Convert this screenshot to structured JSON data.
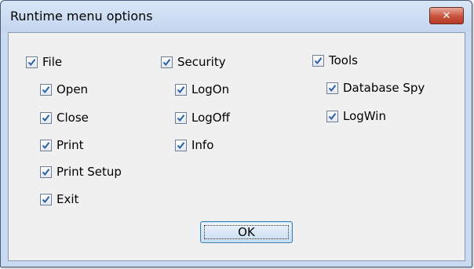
{
  "window": {
    "title": "Runtime menu options",
    "close_icon": "close-icon",
    "close_glyph": "✕"
  },
  "colors": {
    "check": "#2a5fa8",
    "close_button": "#c8533d",
    "title_bar": "#c9daf0",
    "ok_border": "#3c7fb1"
  },
  "groups": {
    "file": {
      "label": "File",
      "checked": true,
      "items": [
        {
          "label": "Open",
          "checked": true
        },
        {
          "label": "Close",
          "checked": true
        },
        {
          "label": "Print",
          "checked": true
        },
        {
          "label": "Print Setup",
          "checked": true
        },
        {
          "label": "Exit",
          "checked": true
        }
      ]
    },
    "security": {
      "label": "Security",
      "checked": true,
      "items": [
        {
          "label": "LogOn",
          "checked": true
        },
        {
          "label": "LogOff",
          "checked": true
        },
        {
          "label": "Info",
          "checked": true
        }
      ]
    },
    "tools": {
      "label": "Tools",
      "checked": true,
      "items": [
        {
          "label": "Database Spy",
          "checked": true
        },
        {
          "label": "LogWin",
          "checked": true
        }
      ]
    }
  },
  "buttons": {
    "ok_label": "OK"
  }
}
